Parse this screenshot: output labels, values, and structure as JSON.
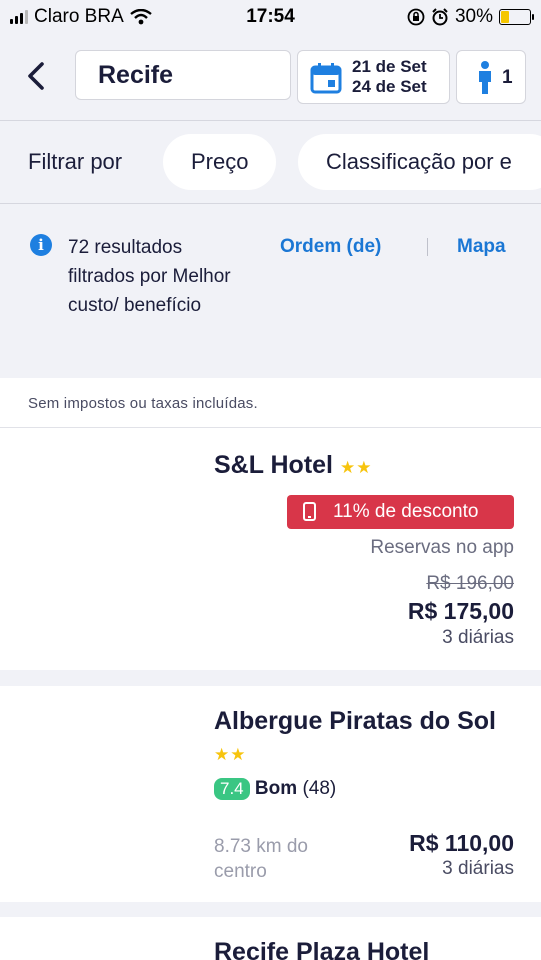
{
  "status_bar": {
    "carrier": "Claro BRA",
    "time": "17:54",
    "battery_percent": "30%",
    "battery_level": 0.3
  },
  "search": {
    "city": "Recife",
    "checkin": "21 de Set",
    "checkout": "24 de Set",
    "guests": "1"
  },
  "filter": {
    "label": "Filtrar por",
    "chips": [
      "Preço",
      "Classificação por e"
    ]
  },
  "results": {
    "summary": "72 resultados filtrados por Melhor custo/ benefício",
    "order_label": "Ordem (de)",
    "map_label": "Mapa",
    "tax_note": "Sem impostos ou taxas incluídas."
  },
  "hotels": [
    {
      "name": "S&L Hotel",
      "stars": "★★",
      "discount": "11% de desconto",
      "app_note": "Reservas no app",
      "old_price": "R$ 196,00",
      "price": "R$ 175,00",
      "nights": "3 diárias"
    },
    {
      "name": "Albergue Piratas do Sol",
      "stars": "★★",
      "score": "7.4",
      "rating_label": "Bom",
      "reviews": "(48)",
      "distance": "8.73 km do centro",
      "price": "R$ 110,00",
      "nights": "3 diárias"
    },
    {
      "name": "Recife Plaza Hotel"
    }
  ],
  "colors": {
    "accent": "#1b77d4",
    "discount": "#d83649",
    "score": "#3ac683",
    "star": "#f7c40e",
    "calendar": "#1e7fe0"
  }
}
